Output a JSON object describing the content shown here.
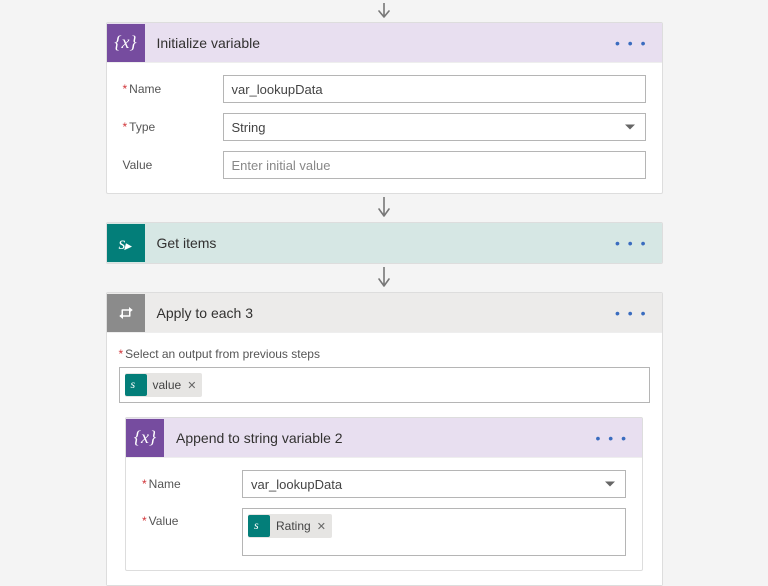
{
  "arrow_alt": "flow-arrow",
  "initVar": {
    "title": "Initialize variable",
    "rows": {
      "name_label": "Name",
      "name_value": "var_lookupData",
      "type_label": "Type",
      "type_value": "String",
      "value_label": "Value",
      "value_placeholder": "Enter initial value"
    }
  },
  "getItems": {
    "title": "Get items"
  },
  "applyEach": {
    "title": "Apply to each 3",
    "select_label": "Select an output from previous steps",
    "token_value": "value"
  },
  "append": {
    "title": "Append to string variable 2",
    "rows": {
      "name_label": "Name",
      "name_value": "var_lookupData",
      "value_label": "Value",
      "token_value": "Rating"
    }
  },
  "menu_dots": "• • •",
  "x_glyph": "✕"
}
